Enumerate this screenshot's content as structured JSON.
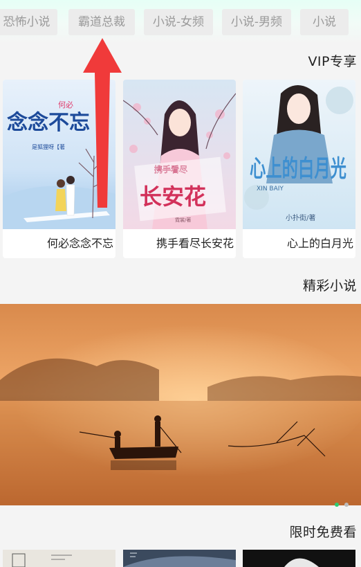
{
  "tabs": [
    "恐怖小说",
    "霸道总裁",
    "小说-女频",
    "小说-男频",
    "小说"
  ],
  "sections": {
    "vip": "VIP专享",
    "featured": "精彩小说",
    "free": "限时免费看"
  },
  "vip_books": [
    {
      "title": "何必念念不忘",
      "cover_title": "念念不忘",
      "cover_prefix": "何必",
      "cover_author": "是狐狸呀【著"
    },
    {
      "title": "携手看尽长安花",
      "cover_title": "长安花",
      "cover_prefix": "携手看尽",
      "cover_author": "霓裳/著"
    },
    {
      "title": "心上的白月光",
      "cover_title": "心上的白月光",
      "cover_latin": "XIN BAIY",
      "cover_author": "小扑街/著"
    }
  ],
  "banner": {
    "active_index": 0,
    "count": 2
  },
  "colors": {
    "arrow": "#f03a3a",
    "dot_active": "#2ecc71",
    "dot_inactive": "#bbbbbb"
  }
}
